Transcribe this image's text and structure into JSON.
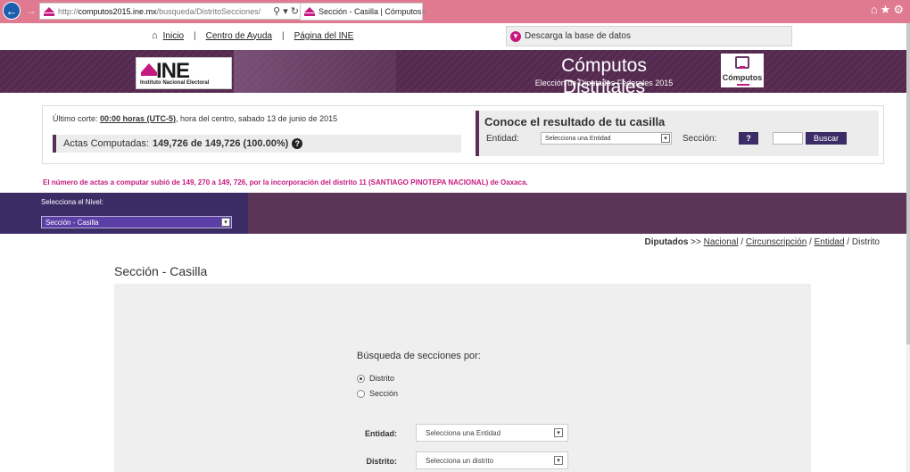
{
  "browser": {
    "address_prefix": "http://",
    "address_host": "computos2015.ine.mx",
    "address_path": "/busqueda/DistritoSecciones/",
    "address_tools": "⚲ ▾ ↻",
    "tab_title": "Sección - Casilla | Cómputos",
    "tab_close": "×",
    "chrome_icons": "⌂★⚙"
  },
  "toplinks": {
    "home": "Inicio",
    "help": "Centro de Ayuda",
    "ine": "Página del INE",
    "download": "Descarga la base de datos"
  },
  "banner": {
    "logo_text": "INE",
    "logo_sub": "Instituto Nacional Electoral",
    "title": "Cómputos Distritales",
    "subtitle": "Elección de Diputados Federales 2015",
    "computos_label": "Cómputos"
  },
  "status": {
    "corte_prefix": "Último corte: ",
    "corte_time": "00:00 horas (UTC-5)",
    "corte_suffix": ", hora del centro, sabado 13 de junio de 2015",
    "actas_label": "Actas Computadas:",
    "actas_value": "149,726 de 149,726 (100.00%)"
  },
  "casilla": {
    "title": "Conoce el resultado de tu casilla",
    "entidad_label": "Entidad:",
    "entidad_select": "Selecciona una Entidad",
    "seccion_label": "Sección:",
    "help_btn": "?",
    "search_btn": "Buscar"
  },
  "notice": "El número de actas a computar subió de 149, 270 a 149, 726, por la incorporación del distrito 11 (SANTIAGO PINOTEPA NACIONAL) de Oaxaca.",
  "nivel": {
    "label": "Selecciona el Nivel:",
    "selected": "Sección - Casilla"
  },
  "breadcrumb": {
    "root": "Diputados",
    "arrow": " >> ",
    "nacional": "Nacional",
    "circ": "Circunscripción",
    "entidad": "Entidad",
    "distrito": "Distrito"
  },
  "main": {
    "title": "Sección - Casilla",
    "search_title": "Búsqueda de secciones por:",
    "radio_distrito": "Distrito",
    "radio_seccion": "Sección",
    "entidad_label": "Entidad:",
    "entidad_select": "Selecciona una Entidad",
    "distrito_label": "Distrito:",
    "distrito_select": "Selecciona un distrito"
  },
  "colors": {
    "brand_purple": "#5b2e56",
    "accent_pink": "#c6197e",
    "button_indigo": "#3b2c66",
    "browser_bar": "#e07a91"
  }
}
